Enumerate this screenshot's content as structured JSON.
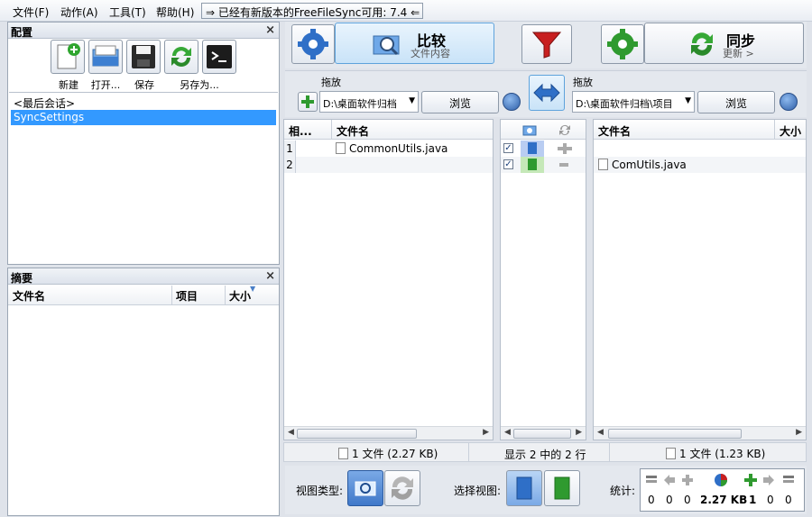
{
  "menu": {
    "file": "文件(F)",
    "actions": "动作(A)",
    "tools": "工具(T)",
    "help": "帮助(H)",
    "update_notice": "⇒ 已经有新版本的FreeFileSync可用: 7.4 ⇐"
  },
  "config_panel": {
    "title": "配置",
    "close": "×",
    "buttons": {
      "new": "新建",
      "open": "打开...",
      "save": "保存",
      "save_as": "另存为..."
    },
    "sessions": [
      "<最后会话>",
      "SyncSettings"
    ],
    "selected_session_index": 1
  },
  "summary_panel": {
    "title": "摘要",
    "close": "×",
    "columns": {
      "filename": "文件名",
      "item": "项目",
      "size": "大小"
    }
  },
  "toolbar": {
    "compare_title": "比较",
    "compare_sub": "文件内容",
    "sync_title": "同步",
    "sync_sub": "更新 >"
  },
  "left_folder": {
    "label": "拖放",
    "path": "D:\\桌面软件归档",
    "browse": "浏览"
  },
  "right_folder": {
    "label": "拖放",
    "path": "D:\\桌面软件归档\\项目",
    "browse": "浏览"
  },
  "grid": {
    "left_columns": {
      "relative": "相...",
      "filename": "文件名"
    },
    "right_columns": {
      "filename": "文件名",
      "size": "大小"
    },
    "rows": [
      {
        "num": "1",
        "left_name": "CommonUtils.java",
        "right_name": "",
        "checked": "✓"
      },
      {
        "num": "2",
        "left_name": "",
        "right_name": "ComUtils.java",
        "checked": "✓"
      }
    ]
  },
  "status": {
    "left": "1 文件 (2.27 KB)",
    "middle": "显示 2 中的 2 行",
    "right": "1 文件 (1.23 KB)"
  },
  "bottom": {
    "view_type_label": "视图类型:",
    "select_view_label": "选择视图:",
    "stats_label": "统计:",
    "stats": [
      "0",
      "0",
      "0",
      "2.27 KB",
      "1",
      "0",
      "0"
    ]
  },
  "colors": {
    "selection": "#3399ff",
    "accent_blue": "#2f6fc7",
    "accent_green": "#2f9a2f",
    "filter_red": "#c82020"
  }
}
